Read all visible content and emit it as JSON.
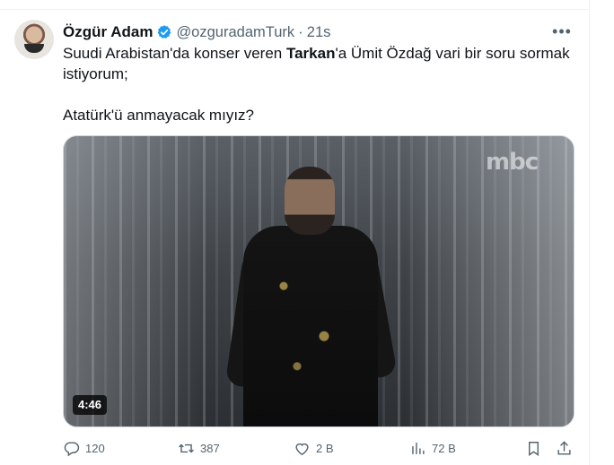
{
  "tweet": {
    "author_name": "Özgür Adam",
    "author_handle": "@ozguradamTurk",
    "separator": "·",
    "timestamp": "21s",
    "verified": true,
    "more_label": "•••",
    "text_line1_pre": "Suudi Arabistan'da konser veren ",
    "text_line1_bold": "Tarkan",
    "text_line1_post": "'a Ümit Özdağ vari bir soru sormak",
    "text_line2": "istiyorum;",
    "text_line3": "Atatürk'ü anmayacak mıyız?",
    "media": {
      "type": "video",
      "duration": "4:46",
      "channel_logo": "mbc"
    }
  },
  "actions": {
    "reply_count": "120",
    "retweet_count": "387",
    "like_count": "2 B",
    "views_count": "72 B"
  },
  "colors": {
    "accent": "#1d9bf0",
    "muted": "#536471",
    "text": "#0f1419"
  }
}
